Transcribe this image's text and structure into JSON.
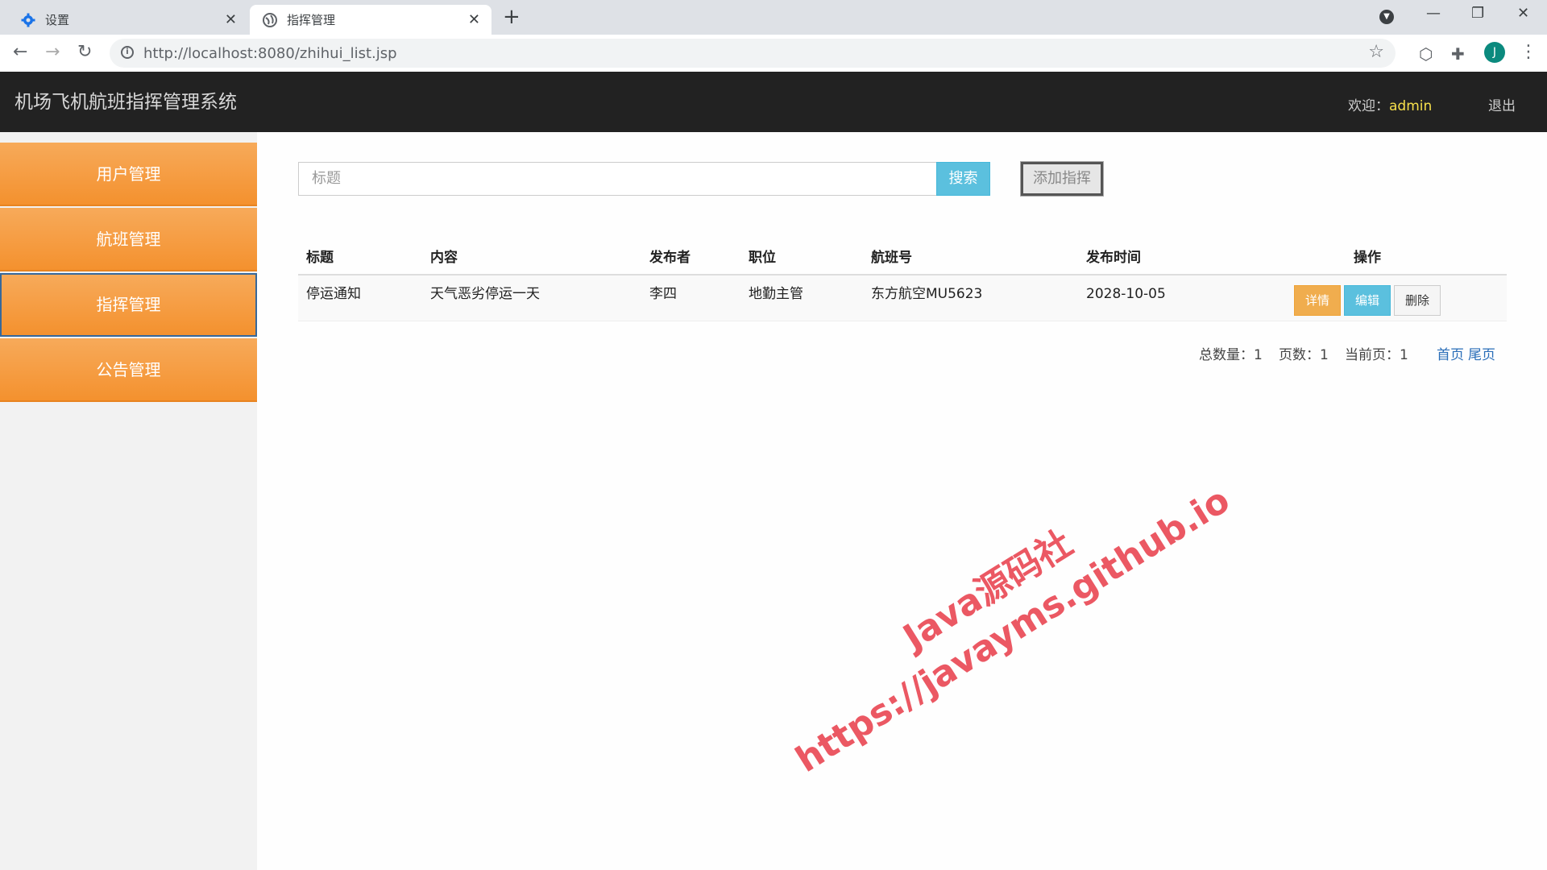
{
  "browser": {
    "tabs": [
      {
        "title": "设置",
        "icon": "gear-icon",
        "active": false
      },
      {
        "title": "指挥管理",
        "icon": "globe-icon",
        "active": true
      }
    ],
    "url_host": "http://localhost:8080",
    "url_path": "/zhihui_list.jsp",
    "profile_initial": "J"
  },
  "app": {
    "title": "机场飞机航班指挥管理系统",
    "welcome_label": "欢迎：",
    "username": "admin",
    "logout": "退出"
  },
  "sidebar": {
    "items": [
      {
        "label": "用户管理"
      },
      {
        "label": "航班管理"
      },
      {
        "label": "指挥管理",
        "active": true
      },
      {
        "label": "公告管理"
      }
    ]
  },
  "search": {
    "placeholder": "标题",
    "button": "搜索",
    "add_button": "添加指挥"
  },
  "table": {
    "headers": [
      "标题",
      "内容",
      "发布者",
      "职位",
      "航班号",
      "发布时间",
      "操作"
    ],
    "rows": [
      {
        "title": "停运通知",
        "content": "天气恶劣停运一天",
        "publisher": "李四",
        "position": "地勤主管",
        "flight": "东方航空MU5623",
        "time": "2028-10-05"
      }
    ],
    "actions": {
      "detail": "详情",
      "edit": "编辑",
      "delete": "删除"
    }
  },
  "pager": {
    "total_label": "总数量：",
    "total": "1",
    "pages_label": "页数：",
    "pages": "1",
    "current_label": "当前页：",
    "current": "1",
    "first": "首页",
    "last": "尾页"
  },
  "watermark": {
    "line1": "Java源码社",
    "line2": "https://javayms.github.io"
  },
  "colors": {
    "sidebar_orange": "#f4912e",
    "header_dark": "#222222",
    "info_blue": "#5bc0de",
    "warning_orange": "#f0ad4e",
    "watermark_red": "#ea4a56"
  }
}
